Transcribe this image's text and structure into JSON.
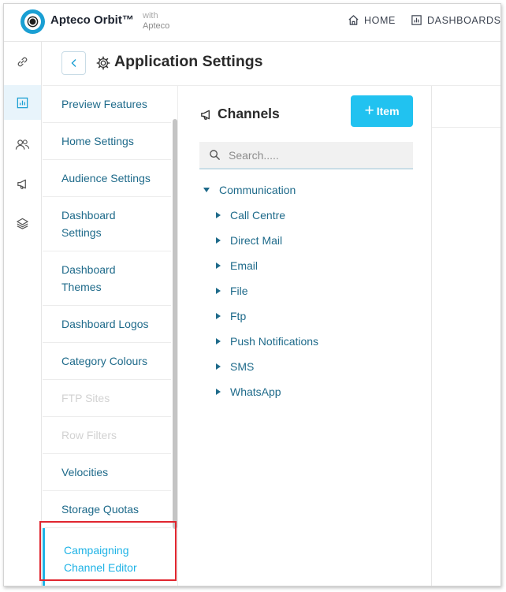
{
  "header": {
    "brand": "Apteco Orbit™",
    "with_line1": "with",
    "with_line2": "Apteco",
    "nav_home": "HOME",
    "nav_dashboards": "DASHBOARDS"
  },
  "rail": {
    "items": [
      "link-icon",
      "chart-icon",
      "users-icon",
      "megaphone-icon",
      "layers-icon"
    ],
    "active_index": 1
  },
  "page": {
    "title": "Application Settings"
  },
  "menu": {
    "items": [
      {
        "label": "Preview Features",
        "state": "normal"
      },
      {
        "label": "Home Settings",
        "state": "normal"
      },
      {
        "label": "Audience Settings",
        "state": "normal"
      },
      {
        "label": "Dashboard Settings",
        "state": "normal"
      },
      {
        "label": "Dashboard Themes",
        "state": "normal"
      },
      {
        "label": "Dashboard Logos",
        "state": "normal"
      },
      {
        "label": "Category Colours",
        "state": "normal"
      },
      {
        "label": "FTP Sites",
        "state": "disabled"
      },
      {
        "label": "Row Filters",
        "state": "disabled"
      },
      {
        "label": "Velocities",
        "state": "normal"
      },
      {
        "label": "Storage Quotas",
        "state": "normal"
      },
      {
        "label": "Campaigning Channel Editor",
        "state": "active"
      }
    ]
  },
  "channels": {
    "title": "Channels",
    "add_label": "Item",
    "search_placeholder": "Search.....",
    "root": "Communication",
    "children": [
      "Call Centre",
      "Direct Mail",
      "Email",
      "File",
      "Ftp",
      "Push Notifications",
      "SMS",
      "WhatsApp"
    ]
  },
  "colors": {
    "accent": "#21c2f0",
    "link": "#1e6a8a",
    "highlight": "#e0262f"
  }
}
